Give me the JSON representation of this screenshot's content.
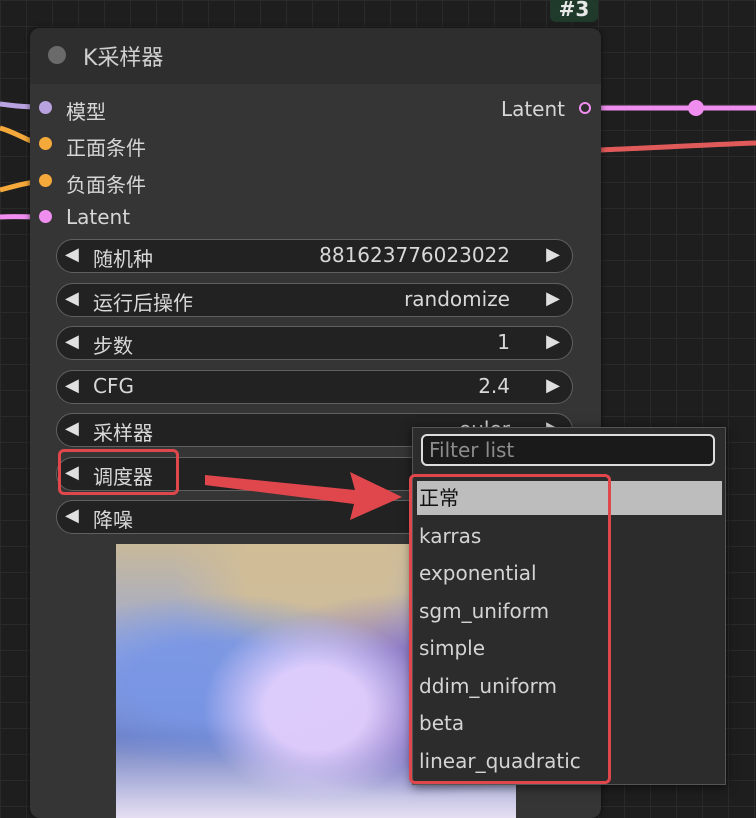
{
  "node_id": "#3",
  "node": {
    "title": "K采样器",
    "inputs": [
      {
        "label": "模型",
        "color": "#b9a2e0"
      },
      {
        "label": "正面条件",
        "color": "#f4a93a"
      },
      {
        "label": "负面条件",
        "color": "#f4a93a"
      },
      {
        "label": "Latent",
        "color": "#f08ef0"
      }
    ],
    "output": {
      "label": "Latent",
      "color": "#f08ef0"
    },
    "widgets": [
      {
        "label": "随机种",
        "value": "881623776023022"
      },
      {
        "label": "运行后操作",
        "value": "randomize"
      },
      {
        "label": "步数",
        "value": "1"
      },
      {
        "label": "CFG",
        "value": "2.4"
      },
      {
        "label": "采样器",
        "value": "euler"
      },
      {
        "label": "调度器",
        "value": ""
      },
      {
        "label": "降噪",
        "value": ""
      }
    ]
  },
  "dropdown": {
    "filter_placeholder": "Filter list",
    "options": [
      "正常",
      "karras",
      "exponential",
      "sgm_uniform",
      "simple",
      "ddim_uniform",
      "beta",
      "linear_quadratic"
    ],
    "selected_index": 0
  },
  "annotation_color": "#e0474c",
  "arrow_glyphs": {
    "left": "◀",
    "right": "▶"
  }
}
